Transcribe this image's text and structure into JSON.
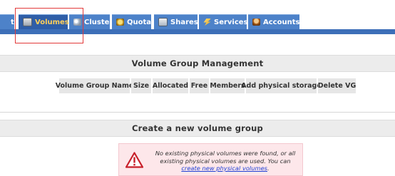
{
  "tabs": [
    {
      "label": "tem",
      "icon": "system-icon"
    },
    {
      "label": "Volumes",
      "icon": "volumes-icon",
      "active": true
    },
    {
      "label": "Cluster",
      "icon": "cluster-icon"
    },
    {
      "label": "Quota",
      "icon": "quota-icon"
    },
    {
      "label": "Shares",
      "icon": "shares-icon"
    },
    {
      "label": "Services",
      "icon": "services-icon"
    },
    {
      "label": "Accounts",
      "icon": "accounts-icon"
    }
  ],
  "vg_management": {
    "title": "Volume Group Management",
    "columns": [
      "Volume Group Name",
      "Size",
      "Allocated",
      "Free",
      "Members",
      "Add physical storage",
      "Delete VG"
    ]
  },
  "create_vg": {
    "title": "Create a new volume group",
    "message_before_link": "No existing physical volumes were found, or all existing physical volumes are used. You can",
    "link_text": "create new physical volumes",
    "message_after_link": "."
  },
  "colors": {
    "tab_bg": "#4d82c9",
    "tab_active_bg": "#2f5ea8",
    "tab_active_text": "#ffcf5a",
    "error_bg": "#fde7ea",
    "link": "#1d3fd6",
    "warning_icon": "#c8202a"
  }
}
